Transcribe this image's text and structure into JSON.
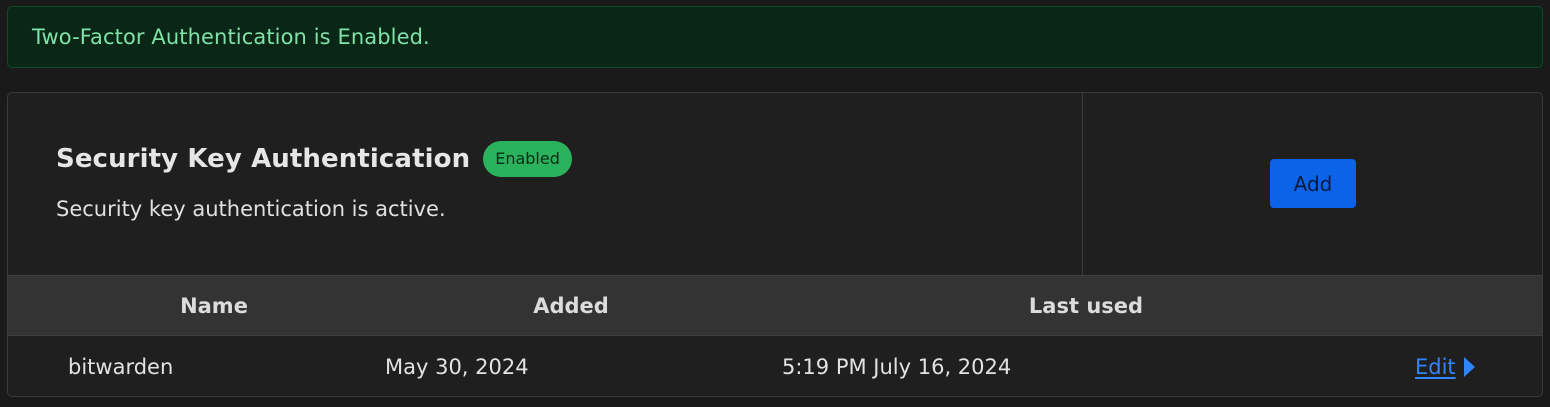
{
  "alert": {
    "message": "Two-Factor Authentication is Enabled."
  },
  "card": {
    "title": "Security Key Authentication",
    "badge": "Enabled",
    "description": "Security key authentication is active.",
    "add_label": "Add"
  },
  "table": {
    "headers": [
      "Name",
      "Added",
      "Last used"
    ],
    "rows": [
      {
        "name": "bitwarden",
        "added": "May 30, 2024",
        "last_used": "5:19 PM July 16, 2024",
        "action_label": "Edit"
      }
    ]
  },
  "icons": {
    "edit_caret": "caret-right-icon"
  },
  "colors": {
    "success_text": "#7fe3a8",
    "success_bg": "#092617",
    "badge_bg": "#2ab35c",
    "primary": "#0d63e8",
    "link": "#2f86ff"
  }
}
